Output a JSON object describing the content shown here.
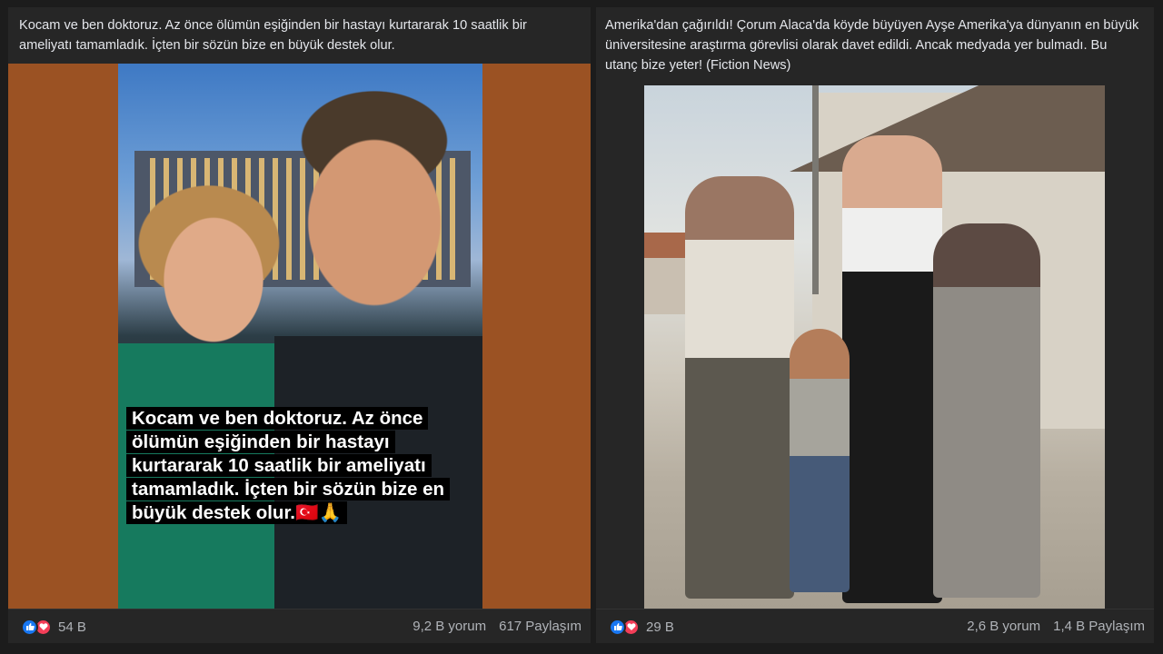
{
  "posts": [
    {
      "text": "Kocam ve ben doktoruz. Az önce ölümün eşiğinden bir hastayı kurtararak 10 saatlik bir ameliyatı tamamladık. İçten bir sözün bize en büyük destek olur.",
      "image_caption_lines": [
        "Kocam ve ben doktoruz. Az önce",
        "ölümün eşiğinden bir hastayı",
        "kurtararak 10 saatlik bir ameliyatı",
        "tamamladık. İçten bir sözün bize en",
        "büyük destek olur.🇹🇷🙏"
      ],
      "reaction_icons": [
        "like-icon",
        "love-icon"
      ],
      "reaction_count": "54 B",
      "comments": "9,2 B yorum",
      "shares": "617 Paylaşım"
    },
    {
      "text": "Amerika'dan çağırıldı! Çorum Alaca'da köyde büyüyen Ayşe Amerika'ya dünyanın en büyük üniversitesine araştırma görevlisi olarak davet edildi. Ancak medyada yer bulmadı. Bu utanç bize yeter! (Fiction News)",
      "reaction_icons": [
        "like-icon",
        "love-icon"
      ],
      "reaction_count": "29 B",
      "comments": "2,6 B yorum",
      "shares": "1,4 B Paylaşım"
    }
  ],
  "colors": {
    "page_bg": "#1c1c1c",
    "post_bg": "#262626",
    "text": "#e4e6eb",
    "muted": "#b0b3b8",
    "like_blue": "#1877f2",
    "love_red": "#f33e58",
    "media_border_orange": "#9b5223"
  }
}
